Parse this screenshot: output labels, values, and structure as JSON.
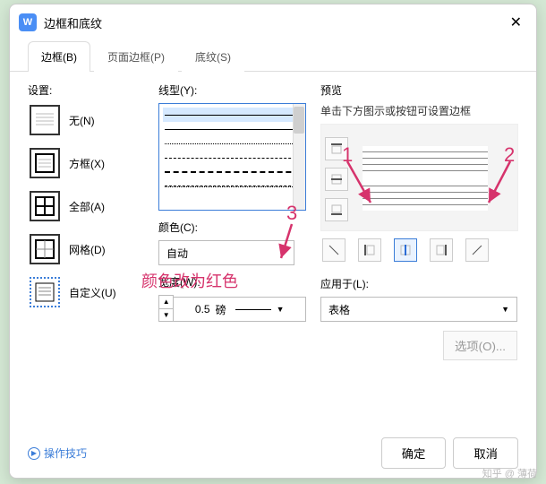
{
  "window": {
    "title": "边框和底纹",
    "app_letter": "W"
  },
  "tabs": [
    {
      "label": "边框(B)"
    },
    {
      "label": "页面边框(P)"
    },
    {
      "label": "底纹(S)"
    }
  ],
  "left": {
    "section": "设置:",
    "items": [
      {
        "label": "无(N)"
      },
      {
        "label": "方框(X)"
      },
      {
        "label": "全部(A)"
      },
      {
        "label": "网格(D)"
      },
      {
        "label": "自定义(U)"
      }
    ]
  },
  "mid": {
    "linetype_label": "线型(Y):",
    "color_label": "颜色(C):",
    "color_value": "自动",
    "width_label": "宽度(W):",
    "width_value": "0.5",
    "width_unit": "磅"
  },
  "right": {
    "preview_label": "预览",
    "preview_hint": "单击下方图示或按钮可设置边框",
    "apply_label": "应用于(L):",
    "apply_value": "表格",
    "options_label": "选项(O)..."
  },
  "footer": {
    "tips": "操作技巧",
    "ok": "确定",
    "cancel": "取消"
  },
  "annotations": {
    "n1": "1",
    "n2": "2",
    "n3": "3",
    "text": "颜色改为红色"
  },
  "watermark": "知乎 @ 薄荷"
}
